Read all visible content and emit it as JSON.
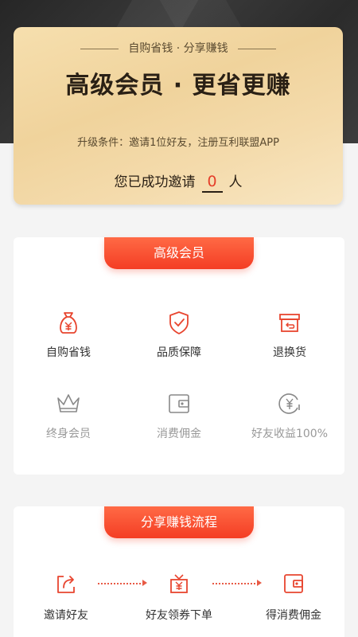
{
  "header": {
    "subtitle": "自购省钱 · 分享赚钱",
    "title": "高级会员 · 更省更赚",
    "condition": "升级条件：邀请1位好友，注册互利联盟APP",
    "invite_prefix": "您已成功邀请",
    "invite_count": "0",
    "invite_suffix": "人"
  },
  "vip_panel": {
    "ribbon": "高级会员",
    "items": [
      {
        "label": "自购省钱",
        "icon": "money-bag-icon",
        "active": true
      },
      {
        "label": "品质保障",
        "icon": "shield-check-icon",
        "active": true
      },
      {
        "label": "退换货",
        "icon": "return-box-icon",
        "active": true
      },
      {
        "label": "终身会员",
        "icon": "crown-icon",
        "active": false
      },
      {
        "label": "消费佣金",
        "icon": "wallet-icon",
        "active": false
      },
      {
        "label": "好友收益100%",
        "icon": "yen-coin-icon",
        "active": false
      }
    ]
  },
  "flow_panel": {
    "ribbon": "分享赚钱流程",
    "steps": [
      {
        "label": "邀请好友",
        "icon": "share-icon"
      },
      {
        "label": "好友领券下单",
        "icon": "coupon-gift-icon"
      },
      {
        "label": "得消费佣金",
        "icon": "wallet-icon"
      }
    ]
  },
  "colors": {
    "accent": "#f43d24",
    "gold": "#f0d39c",
    "dark": "#2a2a2a"
  }
}
